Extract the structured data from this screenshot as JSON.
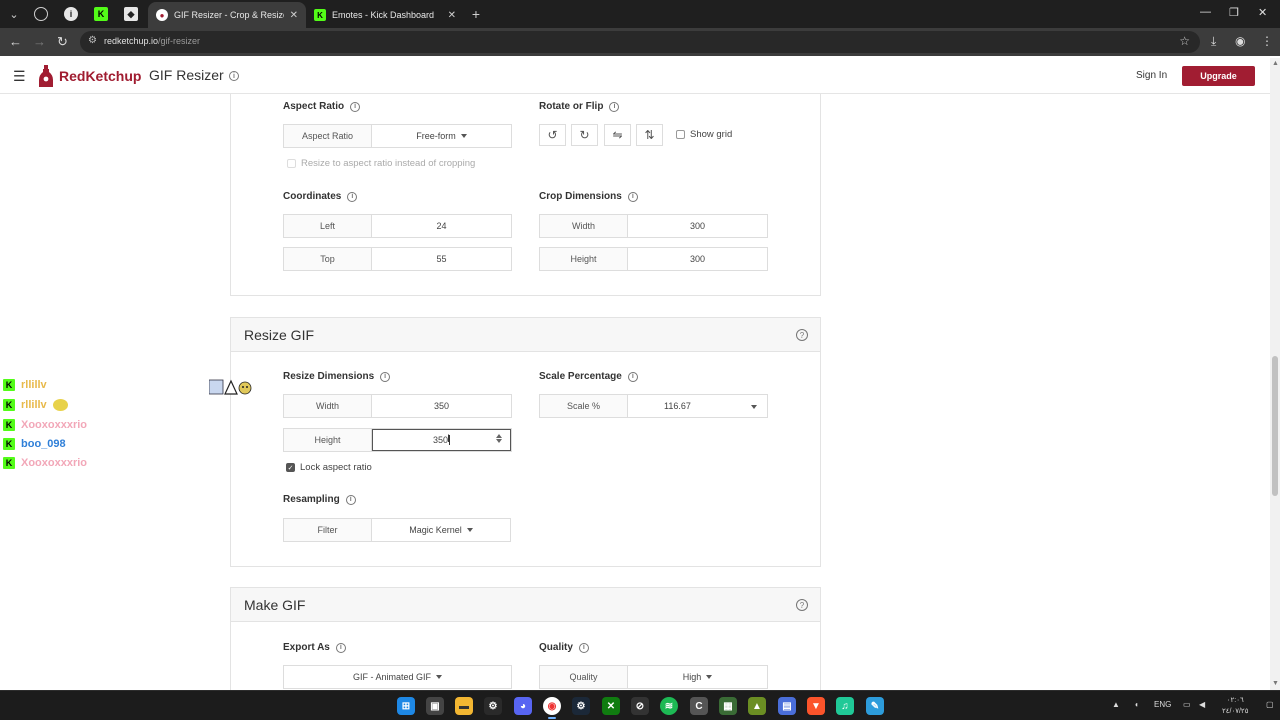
{
  "browser": {
    "tabs": [
      {
        "title": "GIF Resizer - Crop & Resize Ani...",
        "active": true
      },
      {
        "title": "Emotes - Kick Dashboard",
        "active": false
      }
    ],
    "url_host": "redketchup.io",
    "url_path": "/gif-resizer"
  },
  "header": {
    "brand": "RedKetchup",
    "product": "GIF Resizer",
    "sign_in": "Sign In",
    "upgrade": "Upgrade",
    "brand_color": "#a11d32"
  },
  "crop": {
    "aspect_ratio": {
      "label": "Aspect Ratio",
      "field_label": "Aspect Ratio",
      "value": "Free-form"
    },
    "resize_to_aspect": "Resize to aspect ratio instead of cropping",
    "rotate_flip": {
      "label": "Rotate or Flip",
      "show_grid": "Show grid"
    },
    "coordinates": {
      "label": "Coordinates",
      "left_label": "Left",
      "left_value": "24",
      "top_label": "Top",
      "top_value": "55"
    },
    "crop_dimensions": {
      "label": "Crop Dimensions",
      "width_label": "Width",
      "width_value": "300",
      "height_label": "Height",
      "height_value": "300"
    }
  },
  "resize": {
    "title": "Resize GIF",
    "dimensions": {
      "label": "Resize Dimensions",
      "width_label": "Width",
      "width_value": "350",
      "height_label": "Height",
      "height_value": "350"
    },
    "lock_aspect": "Lock aspect ratio",
    "lock_checked": true,
    "scale": {
      "label": "Scale Percentage",
      "field_label": "Scale %",
      "value": "116.67"
    },
    "resampling": {
      "label": "Resampling",
      "field_label": "Filter",
      "value": "Magic Kernel"
    }
  },
  "make": {
    "title": "Make GIF",
    "export": {
      "label": "Export As",
      "value": "GIF - Animated GIF"
    },
    "quality": {
      "label": "Quality",
      "field_label": "Quality",
      "value": "High"
    }
  },
  "chat": [
    {
      "user": "rllillv",
      "color": "#e8b94a",
      "emote": false
    },
    {
      "user": "rllillv",
      "color": "#e8b94a",
      "emote": true
    },
    {
      "user": "Xooxoxxxrio",
      "color": "#f2a7b8",
      "emote": false
    },
    {
      "user": "boo_098",
      "color": "#2f7fd8",
      "emote": false
    },
    {
      "user": "Xooxoxxxrio",
      "color": "#f2a7b8",
      "emote": false
    }
  ],
  "tray": {
    "language": "ENG",
    "clock_time": "٠٢:٠٦",
    "clock_date": "٢٤/٠٧/٢٥"
  }
}
